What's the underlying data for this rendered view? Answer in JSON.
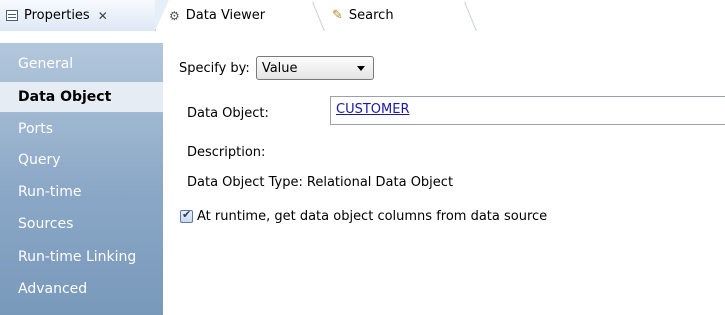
{
  "tabs": [
    {
      "label": "Properties",
      "close": "✕",
      "icon": "properties-icon"
    },
    {
      "label": "Data Viewer",
      "icon": "data-viewer-icon"
    },
    {
      "label": "Search",
      "icon": "search-icon"
    }
  ],
  "sidebar": {
    "items": [
      {
        "label": "General"
      },
      {
        "label": "Data Object",
        "active": true
      },
      {
        "label": "Ports"
      },
      {
        "label": "Query"
      },
      {
        "label": "Run-time"
      },
      {
        "label": "Sources"
      },
      {
        "label": "Run-time Linking"
      },
      {
        "label": "Advanced"
      }
    ]
  },
  "content": {
    "specify_by_label": "Specify by:",
    "specify_by_value": "Value",
    "data_object_label": "Data Object:",
    "data_object_value": "CUSTOMER",
    "description_label": "Description:",
    "type_label": "Data Object Type:",
    "type_value": "Relational Data Object",
    "runtime_checkbox_label": "At runtime, get data object columns from data source",
    "runtime_checkbox_checked": true
  },
  "colors": {
    "sidebar_top": "#b3c7dc",
    "sidebar_bottom": "#7999bb",
    "active_item_bg": "#e6ecf3",
    "link": "#1a1aa6"
  }
}
